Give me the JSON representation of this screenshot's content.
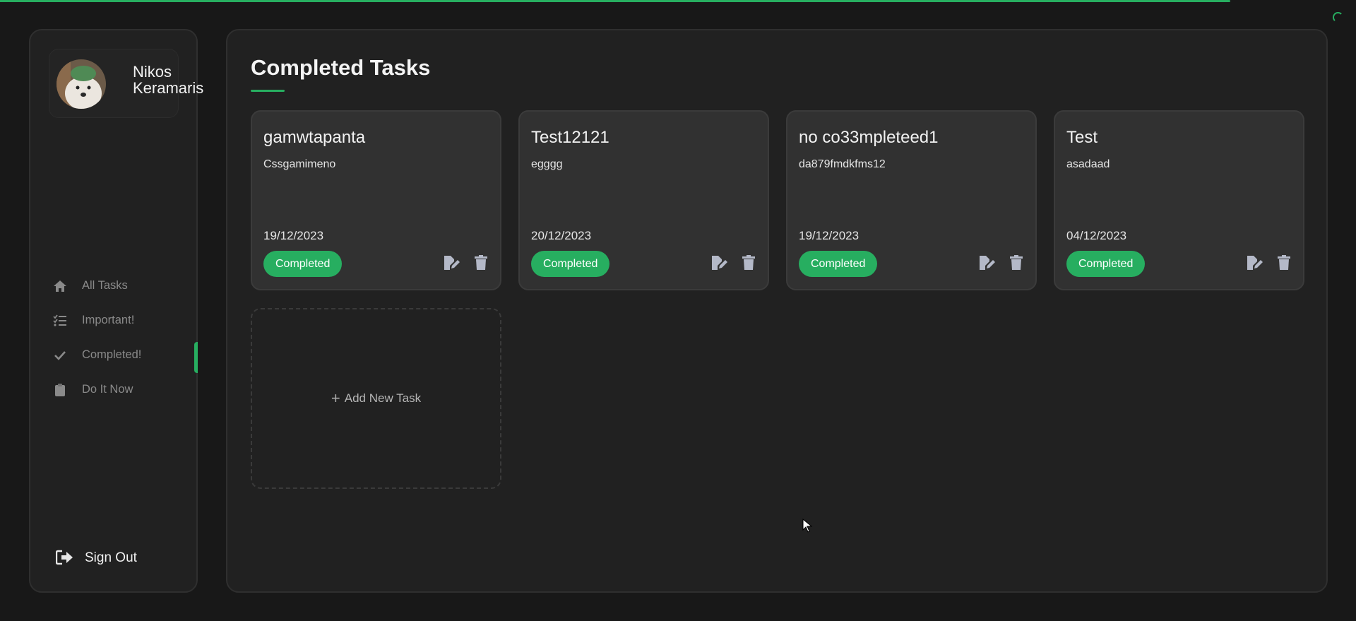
{
  "user": {
    "name": "Nikos Keramaris"
  },
  "nav": {
    "items": [
      {
        "label": "All Tasks",
        "icon": "home-icon"
      },
      {
        "label": "Important!",
        "icon": "list-check-icon"
      },
      {
        "label": "Completed!",
        "icon": "check-icon",
        "active": true
      },
      {
        "label": "Do It Now",
        "icon": "clipboard-icon"
      }
    ],
    "sign_out": "Sign Out"
  },
  "main": {
    "title": "Completed Tasks",
    "add_task_label": "Add New Task"
  },
  "tasks": [
    {
      "title": "gamwtapanta",
      "description": "Cssgamimeno",
      "date": "19/12/2023",
      "status": "Completed"
    },
    {
      "title": "Test12121",
      "description": "egggg",
      "date": "20/12/2023",
      "status": "Completed"
    },
    {
      "title": "no co33mpleteed1",
      "description": "da879fmdkfms12",
      "date": "19/12/2023",
      "status": "Completed"
    },
    {
      "title": "Test",
      "description": "asadaad",
      "date": "04/12/2023",
      "status": "Completed"
    }
  ],
  "colors": {
    "accent": "#27ae60",
    "background": "#181818",
    "panel": "#212121",
    "card": "#313131"
  }
}
